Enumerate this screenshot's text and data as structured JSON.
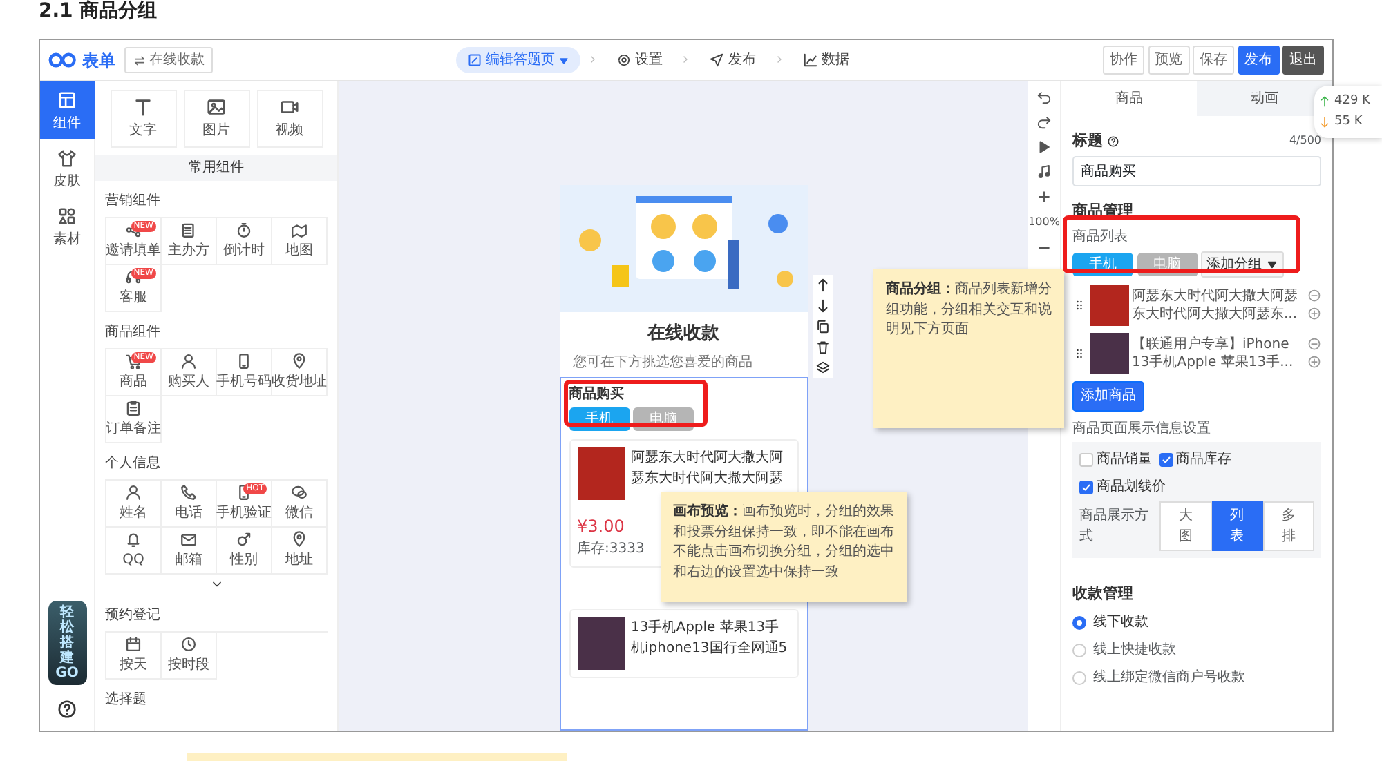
{
  "doc_heading": "2.1 商品分组",
  "header": {
    "logo": "表单",
    "form_name": "在线收款",
    "steps": [
      {
        "label": "编辑答题页",
        "selected": true
      },
      {
        "label": "设置",
        "selected": false
      },
      {
        "label": "发布",
        "selected": false
      },
      {
        "label": "数据",
        "selected": false
      }
    ],
    "actions": [
      {
        "label": "协作",
        "kind": "plain"
      },
      {
        "label": "预览",
        "kind": "plain"
      },
      {
        "label": "保存",
        "kind": "plain"
      },
      {
        "label": "发布",
        "kind": "primary"
      },
      {
        "label": "退出",
        "kind": "dark"
      }
    ]
  },
  "rail": [
    {
      "label": "组件",
      "selected": true
    },
    {
      "label": "皮肤",
      "selected": false
    },
    {
      "label": "素材",
      "selected": false
    }
  ],
  "promo": {
    "title": "轻松搭建",
    "go": "GO"
  },
  "basic_components": [
    "文字",
    "图片",
    "视频"
  ],
  "panel_header": "常用组件",
  "groups": [
    {
      "title": "营销组件",
      "items": [
        {
          "label": "邀请填单",
          "tag": "NEW"
        },
        {
          "label": "主办方"
        },
        {
          "label": "倒计时"
        },
        {
          "label": "地图"
        },
        {
          "label": "客服",
          "tag": "NEW"
        }
      ]
    },
    {
      "title": "商品组件",
      "items": [
        {
          "label": "商品",
          "tag": "NEW"
        },
        {
          "label": "购买人"
        },
        {
          "label": "手机号码"
        },
        {
          "label": "收货地址"
        },
        {
          "label": "订单备注"
        }
      ]
    },
    {
      "title": "个人信息",
      "items": [
        {
          "label": "姓名"
        },
        {
          "label": "电话"
        },
        {
          "label": "手机验证",
          "tag": "HOT"
        },
        {
          "label": "微信"
        },
        {
          "label": "QQ"
        },
        {
          "label": "邮箱"
        },
        {
          "label": "性别"
        },
        {
          "label": "地址"
        }
      ]
    },
    {
      "title": "预约登记",
      "items": [
        {
          "label": "按天"
        },
        {
          "label": "按时段"
        }
      ]
    }
  ],
  "more_group": "选择题",
  "canvas": {
    "title": "在线收款",
    "subtitle": "您可在下方挑选您喜爱的商品",
    "block_label": "商品购买",
    "tabs": [
      {
        "label": "手机",
        "selected": true
      },
      {
        "label": "电脑",
        "selected": false
      }
    ],
    "products": [
      {
        "text": "阿瑟东大时代阿大撒大阿瑟东大时代阿大撒大阿瑟",
        "price": "¥3.00",
        "stock": "库存:3333"
      },
      {
        "text": "13手机Apple 苹果13手机iphone13国行全网通5"
      }
    ]
  },
  "zoom": "100%",
  "settings": {
    "tabs": [
      {
        "label": "商品",
        "selected": true
      },
      {
        "label": "动画",
        "selected": false
      }
    ],
    "title_label": "标题",
    "counter": "4/500",
    "title_value": "商品购买",
    "section": "商品管理",
    "list_label": "商品列表",
    "groups": [
      {
        "label": "手机",
        "selected": true
      },
      {
        "label": "电脑",
        "selected": false
      }
    ],
    "add_group": "添加分组",
    "items": [
      {
        "text": "阿瑟东大时代阿大撒大阿瑟东大时代阿大撒大阿瑟东..."
      },
      {
        "text": "【联通用户专享】iPhone 13手机Apple 苹果13手..."
      }
    ],
    "add_product": "添加商品",
    "display_label": "商品页面展示信息设置",
    "options": [
      {
        "label": "商品销量",
        "checked": false
      },
      {
        "label": "商品库存",
        "checked": true
      },
      {
        "label": "商品划线价",
        "checked": true
      }
    ],
    "mode_label": "商品展示方式",
    "modes": [
      {
        "label": "大图",
        "selected": false
      },
      {
        "label": "列表",
        "selected": true
      },
      {
        "label": "多排",
        "selected": false
      }
    ],
    "payment_title": "收款管理",
    "payments": [
      {
        "label": "线下收款",
        "selected": true
      },
      {
        "label": "线上快捷收款",
        "selected": false
      },
      {
        "label": "线上绑定微信商户号收款",
        "selected": false
      }
    ]
  },
  "network": {
    "up": "429 K",
    "down": "55 K"
  },
  "notes": [
    {
      "text": "**商品分组：**商品列表新增分组功能，分组相关交互和说明见下方页面"
    },
    {
      "text": "**画布预览：**画布预览时，分组的效果和投票分组保持一致，即不能在画布不能点击画布切换分组，分组的选中和右边的设置选中保持一致"
    }
  ]
}
